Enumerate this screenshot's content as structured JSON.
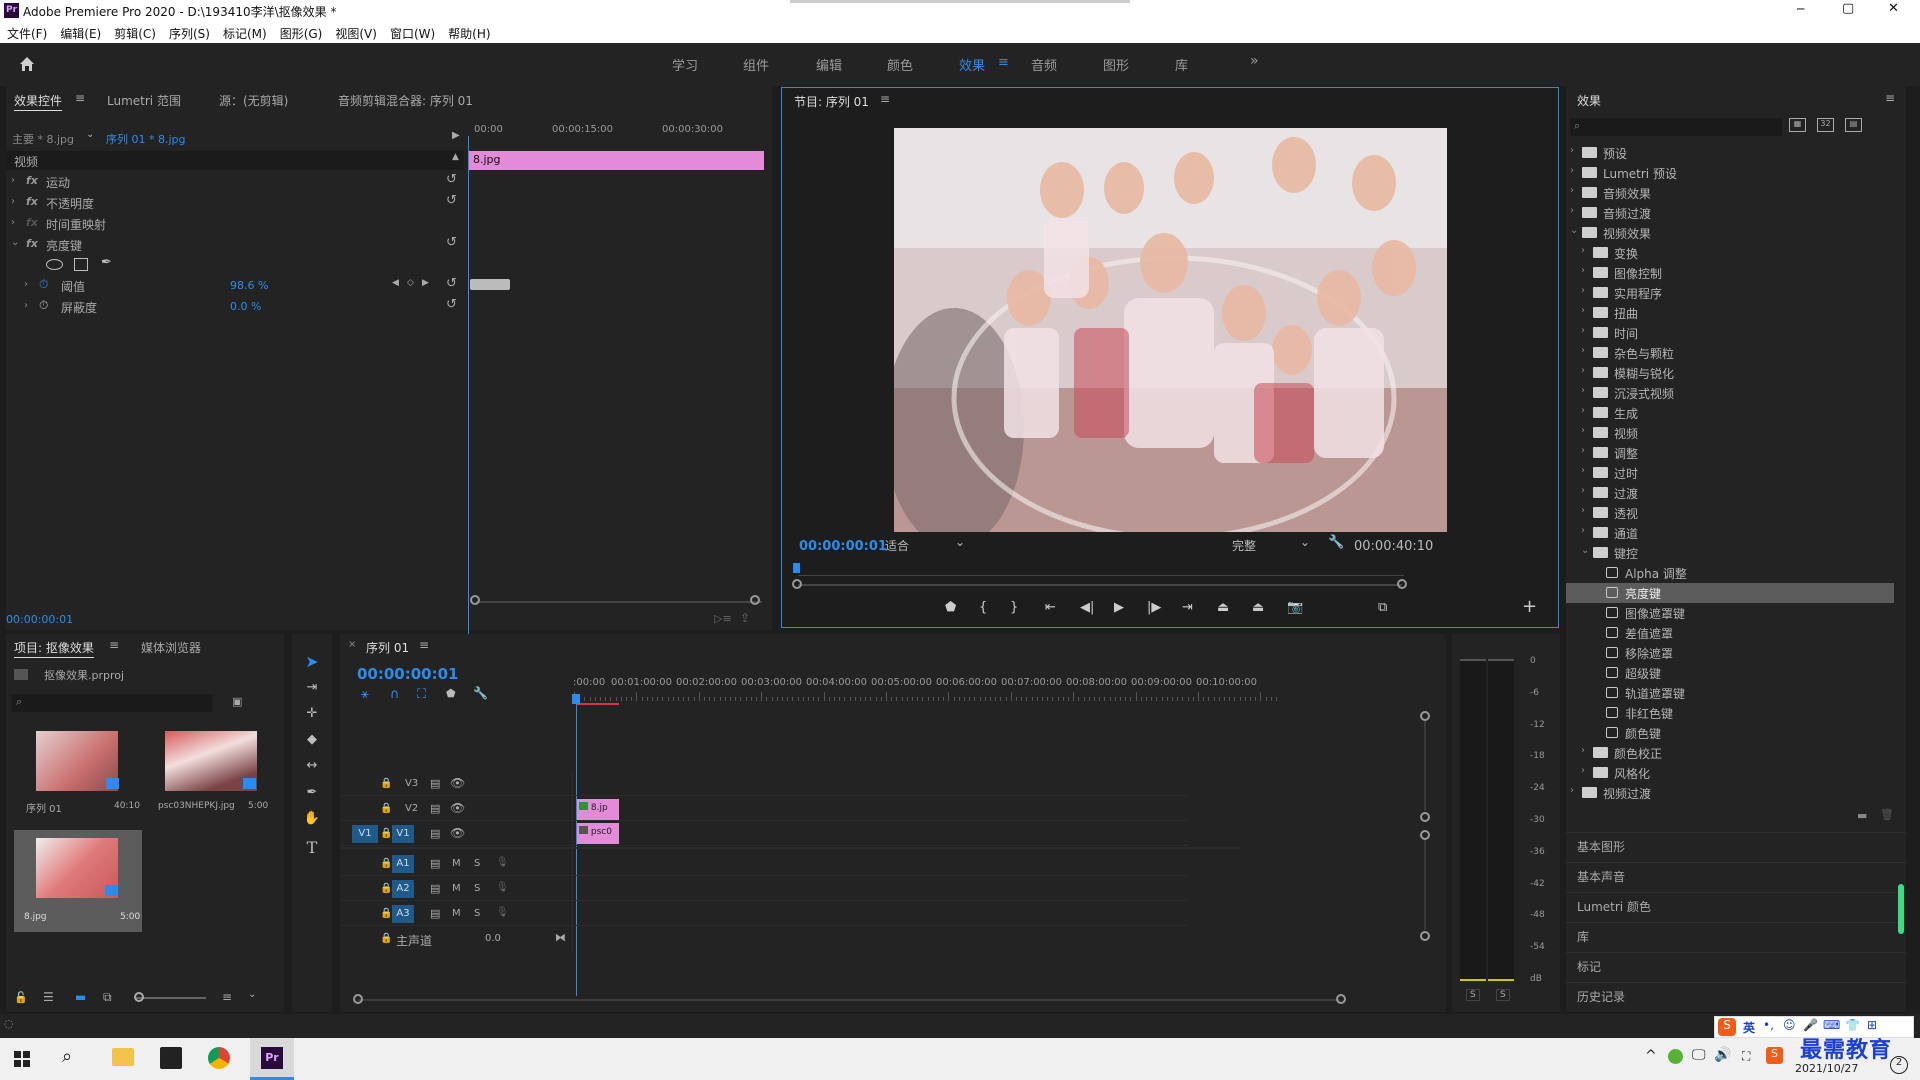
{
  "window": {
    "title": "Adobe Premiere Pro 2020 - D:\\193410李洋\\抠像效果 *",
    "app_badge": "Pr",
    "controls": [
      "─",
      "▢",
      "✕"
    ]
  },
  "menu": [
    "文件(F)",
    "编辑(E)",
    "剪辑(C)",
    "序列(S)",
    "标记(M)",
    "图形(G)",
    "视图(V)",
    "窗口(W)",
    "帮助(H)"
  ],
  "workspaces": {
    "tabs": [
      "学习",
      "组件",
      "编辑",
      "颜色",
      "效果",
      "音频",
      "图形",
      "库"
    ],
    "active": "效果",
    "more": "»"
  },
  "effect_controls": {
    "tabs": [
      "效果控件",
      "Lumetri 范围",
      "源：(无剪辑)",
      "音频剪辑混合器: 序列 01"
    ],
    "master": "主要 * 8.jpg",
    "sequence": "序列 01 * 8.jpg",
    "ruler": [
      "00:00",
      "00:00:15:00",
      "00:00:30:00"
    ],
    "clip_label": "8.jpg",
    "section": "视频",
    "effects": [
      "运动",
      "不透明度",
      "时间重映射",
      "亮度键"
    ],
    "params": [
      {
        "name": "阈值",
        "value": "98.6 %"
      },
      {
        "name": "屏蔽度",
        "value": "0.0 %"
      }
    ],
    "timecode": "00:00:00:01"
  },
  "program_monitor": {
    "title": "节目: 序列 01",
    "timecode": "00:00:00:01",
    "fit": "适合",
    "quality": "完整",
    "duration": "00:00:40:10"
  },
  "effects_panel": {
    "title": "效果",
    "search_placeholder": "",
    "items": [
      {
        "label": "预设",
        "level": 0,
        "type": "folder",
        "expanded": false
      },
      {
        "label": "Lumetri 预设",
        "level": 0,
        "type": "folder",
        "expanded": false
      },
      {
        "label": "音频效果",
        "level": 0,
        "type": "folder",
        "expanded": false
      },
      {
        "label": "音频过渡",
        "level": 0,
        "type": "folder",
        "expanded": false
      },
      {
        "label": "视频效果",
        "level": 0,
        "type": "folder",
        "expanded": true
      },
      {
        "label": "变换",
        "level": 1,
        "type": "folder",
        "expanded": false
      },
      {
        "label": "图像控制",
        "level": 1,
        "type": "folder",
        "expanded": false
      },
      {
        "label": "实用程序",
        "level": 1,
        "type": "folder",
        "expanded": false
      },
      {
        "label": "扭曲",
        "level": 1,
        "type": "folder",
        "expanded": false
      },
      {
        "label": "时间",
        "level": 1,
        "type": "folder",
        "expanded": false
      },
      {
        "label": "杂色与颗粒",
        "level": 1,
        "type": "folder",
        "expanded": false
      },
      {
        "label": "模糊与锐化",
        "level": 1,
        "type": "folder",
        "expanded": false
      },
      {
        "label": "沉浸式视频",
        "level": 1,
        "type": "folder",
        "expanded": false
      },
      {
        "label": "生成",
        "level": 1,
        "type": "folder",
        "expanded": false
      },
      {
        "label": "视频",
        "level": 1,
        "type": "folder",
        "expanded": false
      },
      {
        "label": "调整",
        "level": 1,
        "type": "folder",
        "expanded": false
      },
      {
        "label": "过时",
        "level": 1,
        "type": "folder",
        "expanded": false
      },
      {
        "label": "过渡",
        "level": 1,
        "type": "folder",
        "expanded": false
      },
      {
        "label": "透视",
        "level": 1,
        "type": "folder",
        "expanded": false
      },
      {
        "label": "通道",
        "level": 1,
        "type": "folder",
        "expanded": false
      },
      {
        "label": "键控",
        "level": 1,
        "type": "folder",
        "expanded": true
      },
      {
        "label": "Alpha 调整",
        "level": 2,
        "type": "effect"
      },
      {
        "label": "亮度键",
        "level": 2,
        "type": "effect",
        "selected": true
      },
      {
        "label": "图像遮罩键",
        "level": 2,
        "type": "effect"
      },
      {
        "label": "差值遮罩",
        "level": 2,
        "type": "effect"
      },
      {
        "label": "移除遮罩",
        "level": 2,
        "type": "effect"
      },
      {
        "label": "超级键",
        "level": 2,
        "type": "effect"
      },
      {
        "label": "轨道遮罩键",
        "level": 2,
        "type": "effect"
      },
      {
        "label": "非红色键",
        "level": 2,
        "type": "effect"
      },
      {
        "label": "颜色键",
        "level": 2,
        "type": "effect"
      },
      {
        "label": "颜色校正",
        "level": 1,
        "type": "folder",
        "expanded": false
      },
      {
        "label": "风格化",
        "level": 1,
        "type": "folder",
        "expanded": false
      },
      {
        "label": "视频过渡",
        "level": 0,
        "type": "folder",
        "expanded": false
      }
    ],
    "other_panels": [
      "基本图形",
      "基本声音",
      "Lumetri 颜色",
      "库",
      "标记",
      "历史记录"
    ]
  },
  "project": {
    "tabs": [
      "项目: 抠像效果",
      "媒体浏览器"
    ],
    "file": "抠像效果.prproj",
    "items": [
      {
        "name": "序列 01",
        "duration": "40:10"
      },
      {
        "name": "psc03NHEPKJ.jpg",
        "duration": "5:00"
      },
      {
        "name": "8.jpg",
        "duration": "5:00"
      }
    ]
  },
  "timeline": {
    "title": "序列 01",
    "timecode": "00:00:00:01",
    "ruler": [
      ":00:00",
      "00:01:00:00",
      "00:02:00:00",
      "00:03:00:00",
      "00:04:00:00",
      "00:05:00:00",
      "00:06:00:00",
      "00:07:00:00",
      "00:08:00:00",
      "00:09:00:00",
      "00:10:00:00"
    ],
    "video_tracks": [
      "V3",
      "V2",
      "V1"
    ],
    "audio_tracks": [
      "A1",
      "A2",
      "A3"
    ],
    "source_patch": "V1",
    "master": "主声道",
    "master_value": "0.0",
    "clips": [
      {
        "track": "V2",
        "label": "8.jp"
      },
      {
        "track": "V1",
        "label": "psc0"
      }
    ]
  },
  "audio_meter": {
    "scale": [
      "0",
      "-6",
      "-12",
      "-18",
      "-24",
      "-30",
      "-36",
      "-42",
      "-48",
      "-54",
      "dB"
    ],
    "solo": [
      "S",
      "S"
    ]
  },
  "taskbar": {
    "date": "2021/10/27",
    "watermark": "最需教育",
    "ime": "英",
    "tray_badge": "2"
  }
}
